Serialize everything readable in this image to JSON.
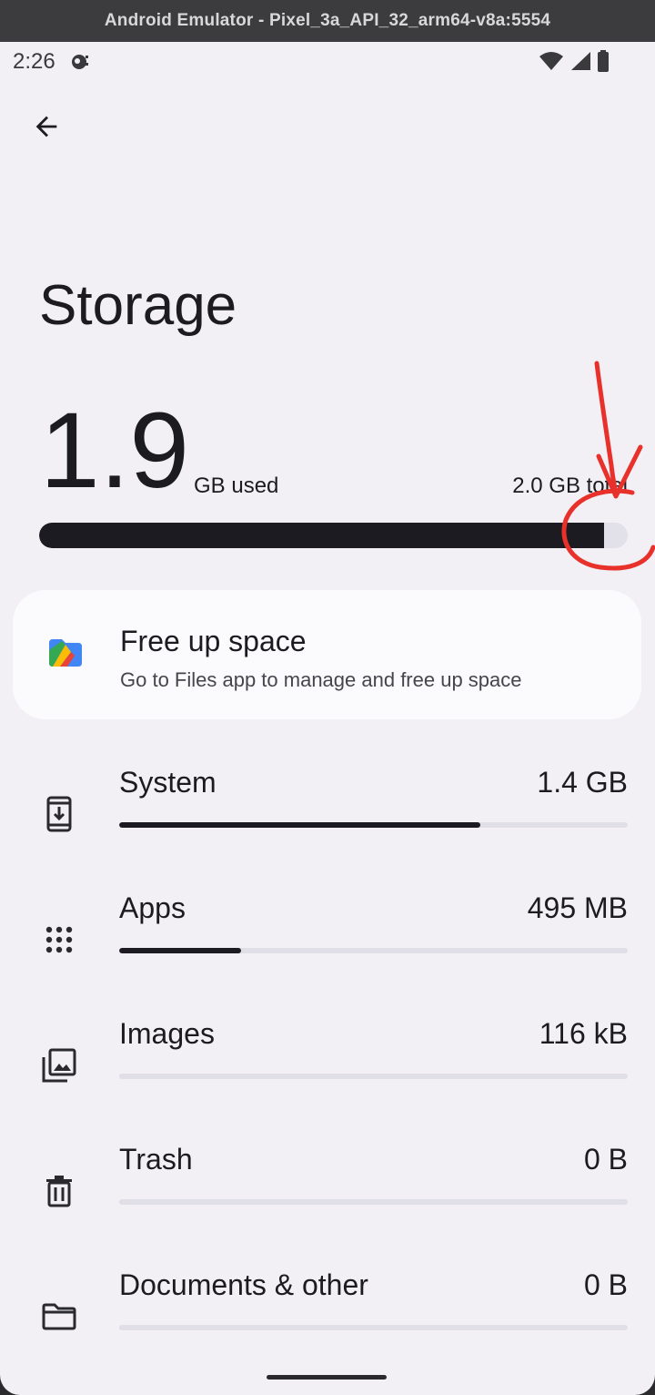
{
  "window": {
    "title": "Android Emulator - Pixel_3a_API_32_arm64-v8a:5554"
  },
  "status_bar": {
    "time": "2:26",
    "icons": [
      "notification-icon",
      "wifi-icon",
      "signal-icon",
      "battery-icon"
    ]
  },
  "header": {
    "back_icon": "arrow-back-icon",
    "title": "Storage"
  },
  "summary": {
    "used_value": "1.9",
    "used_unit": "GB used",
    "total_label": "2.0 GB total",
    "used_fraction": 0.96
  },
  "annotation": {
    "color": "#e8312a",
    "description_icons": [
      "red-arrow",
      "red-circle"
    ]
  },
  "free_up": {
    "icon": "files-app-icon",
    "title": "Free up space",
    "subtitle": "Go to Files app to manage and free up space"
  },
  "categories": [
    {
      "icon": "system-update-icon",
      "label": "System",
      "value": "1.4 GB",
      "fraction": 0.71
    },
    {
      "icon": "apps-grid-icon",
      "label": "Apps",
      "value": "495 MB",
      "fraction": 0.24
    },
    {
      "icon": "images-icon",
      "label": "Images",
      "value": "116 kB",
      "fraction": 0.0
    },
    {
      "icon": "trash-icon",
      "label": "Trash",
      "value": "0 B",
      "fraction": 0.0
    },
    {
      "icon": "folder-icon",
      "label": "Documents & other",
      "value": "0 B",
      "fraction": 0.0
    }
  ],
  "colors": {
    "background": "#f2f0f5",
    "bar_fill": "#1c1b22",
    "bar_track": "#e2e1ea",
    "card": "#fbfbfd",
    "annotation_red": "#e8312a"
  }
}
